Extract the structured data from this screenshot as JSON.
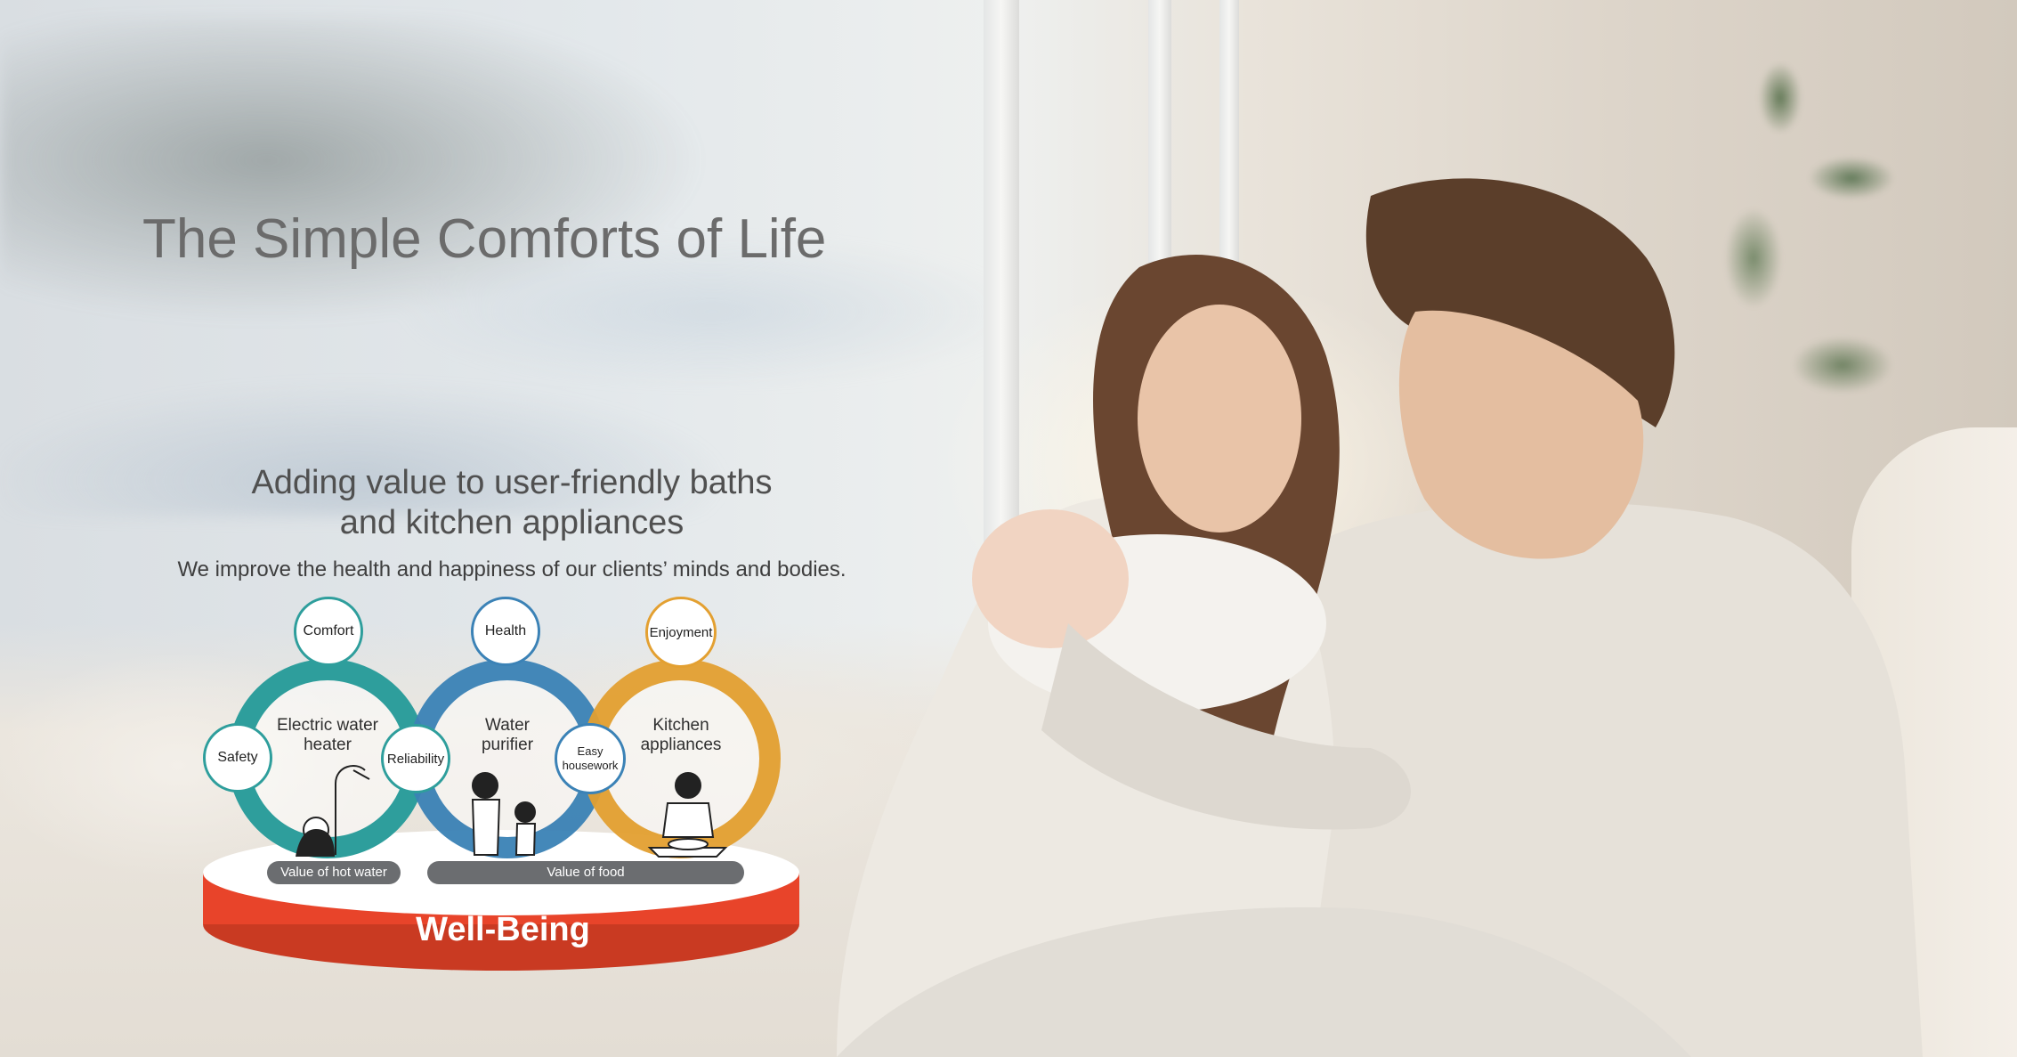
{
  "hero": {
    "title": "The Simple Comforts of Life",
    "subtitle_line1": "Adding value to user-friendly baths",
    "subtitle_line2": "and kitchen appliances",
    "caption": "We improve the health and happiness of our clients’ minds and bodies."
  },
  "diagram": {
    "rings": [
      {
        "label_line1": "Electric water",
        "label_line2": "heater",
        "color": "#2e9e9c"
      },
      {
        "label_line1": "Water",
        "label_line2": "purifier",
        "color": "#3b82b6"
      },
      {
        "label_line1": "Kitchen",
        "label_line2": "appliances",
        "color": "#e3a031"
      }
    ],
    "nodes": {
      "comfort": "Comfort",
      "health": "Health",
      "enjoyment": "Enjoyment",
      "safety": "Safety",
      "reliability": "Reliability",
      "easy_line1": "Easy",
      "easy_line2": "housework"
    },
    "platform": {
      "hot_water_label": "Value of hot water",
      "food_label": "Value of food",
      "well_being": "Well-Being",
      "base_color": "#e8442a"
    }
  }
}
